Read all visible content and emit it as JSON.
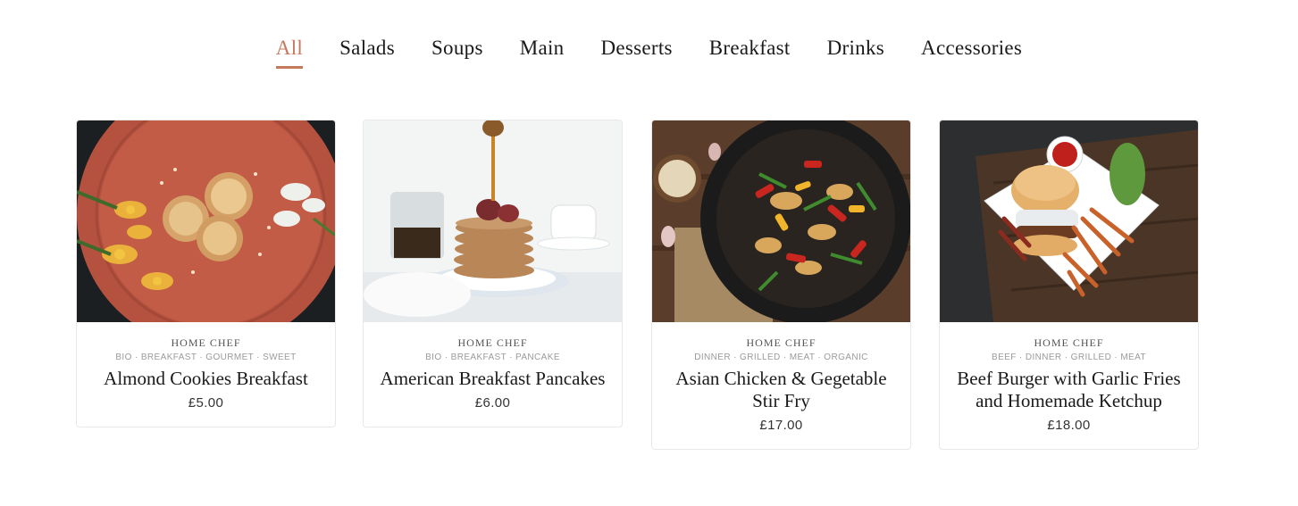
{
  "nav": {
    "tabs": [
      {
        "label": "All",
        "active": true
      },
      {
        "label": "Salads"
      },
      {
        "label": "Soups"
      },
      {
        "label": "Main"
      },
      {
        "label": "Desserts"
      },
      {
        "label": "Breakfast"
      },
      {
        "label": "Drinks"
      },
      {
        "label": "Accessories"
      }
    ],
    "accent_color": "#c4785c"
  },
  "products": [
    {
      "vendor": "HOME CHEF",
      "tags": "BIO · BREAKFAST · GOURMET · SWEET",
      "title": "Almond Cookies Breakfast",
      "price": "£5.00"
    },
    {
      "vendor": "HOME CHEF",
      "tags": "BIO · BREAKFAST · PANCAKE",
      "title": "American Breakfast Pancakes",
      "price": "£6.00"
    },
    {
      "vendor": "HOME CHEF",
      "tags": "DINNER · GRILLED · MEAT · ORGANIC",
      "title": "Asian Chicken & Gegetable Stir Fry",
      "price": "£17.00"
    },
    {
      "vendor": "HOME CHEF",
      "tags": "BEEF · DINNER · GRILLED · MEAT",
      "title": "Beef Burger with Garlic Fries and Homemade Ketchup",
      "price": "£18.00"
    }
  ]
}
